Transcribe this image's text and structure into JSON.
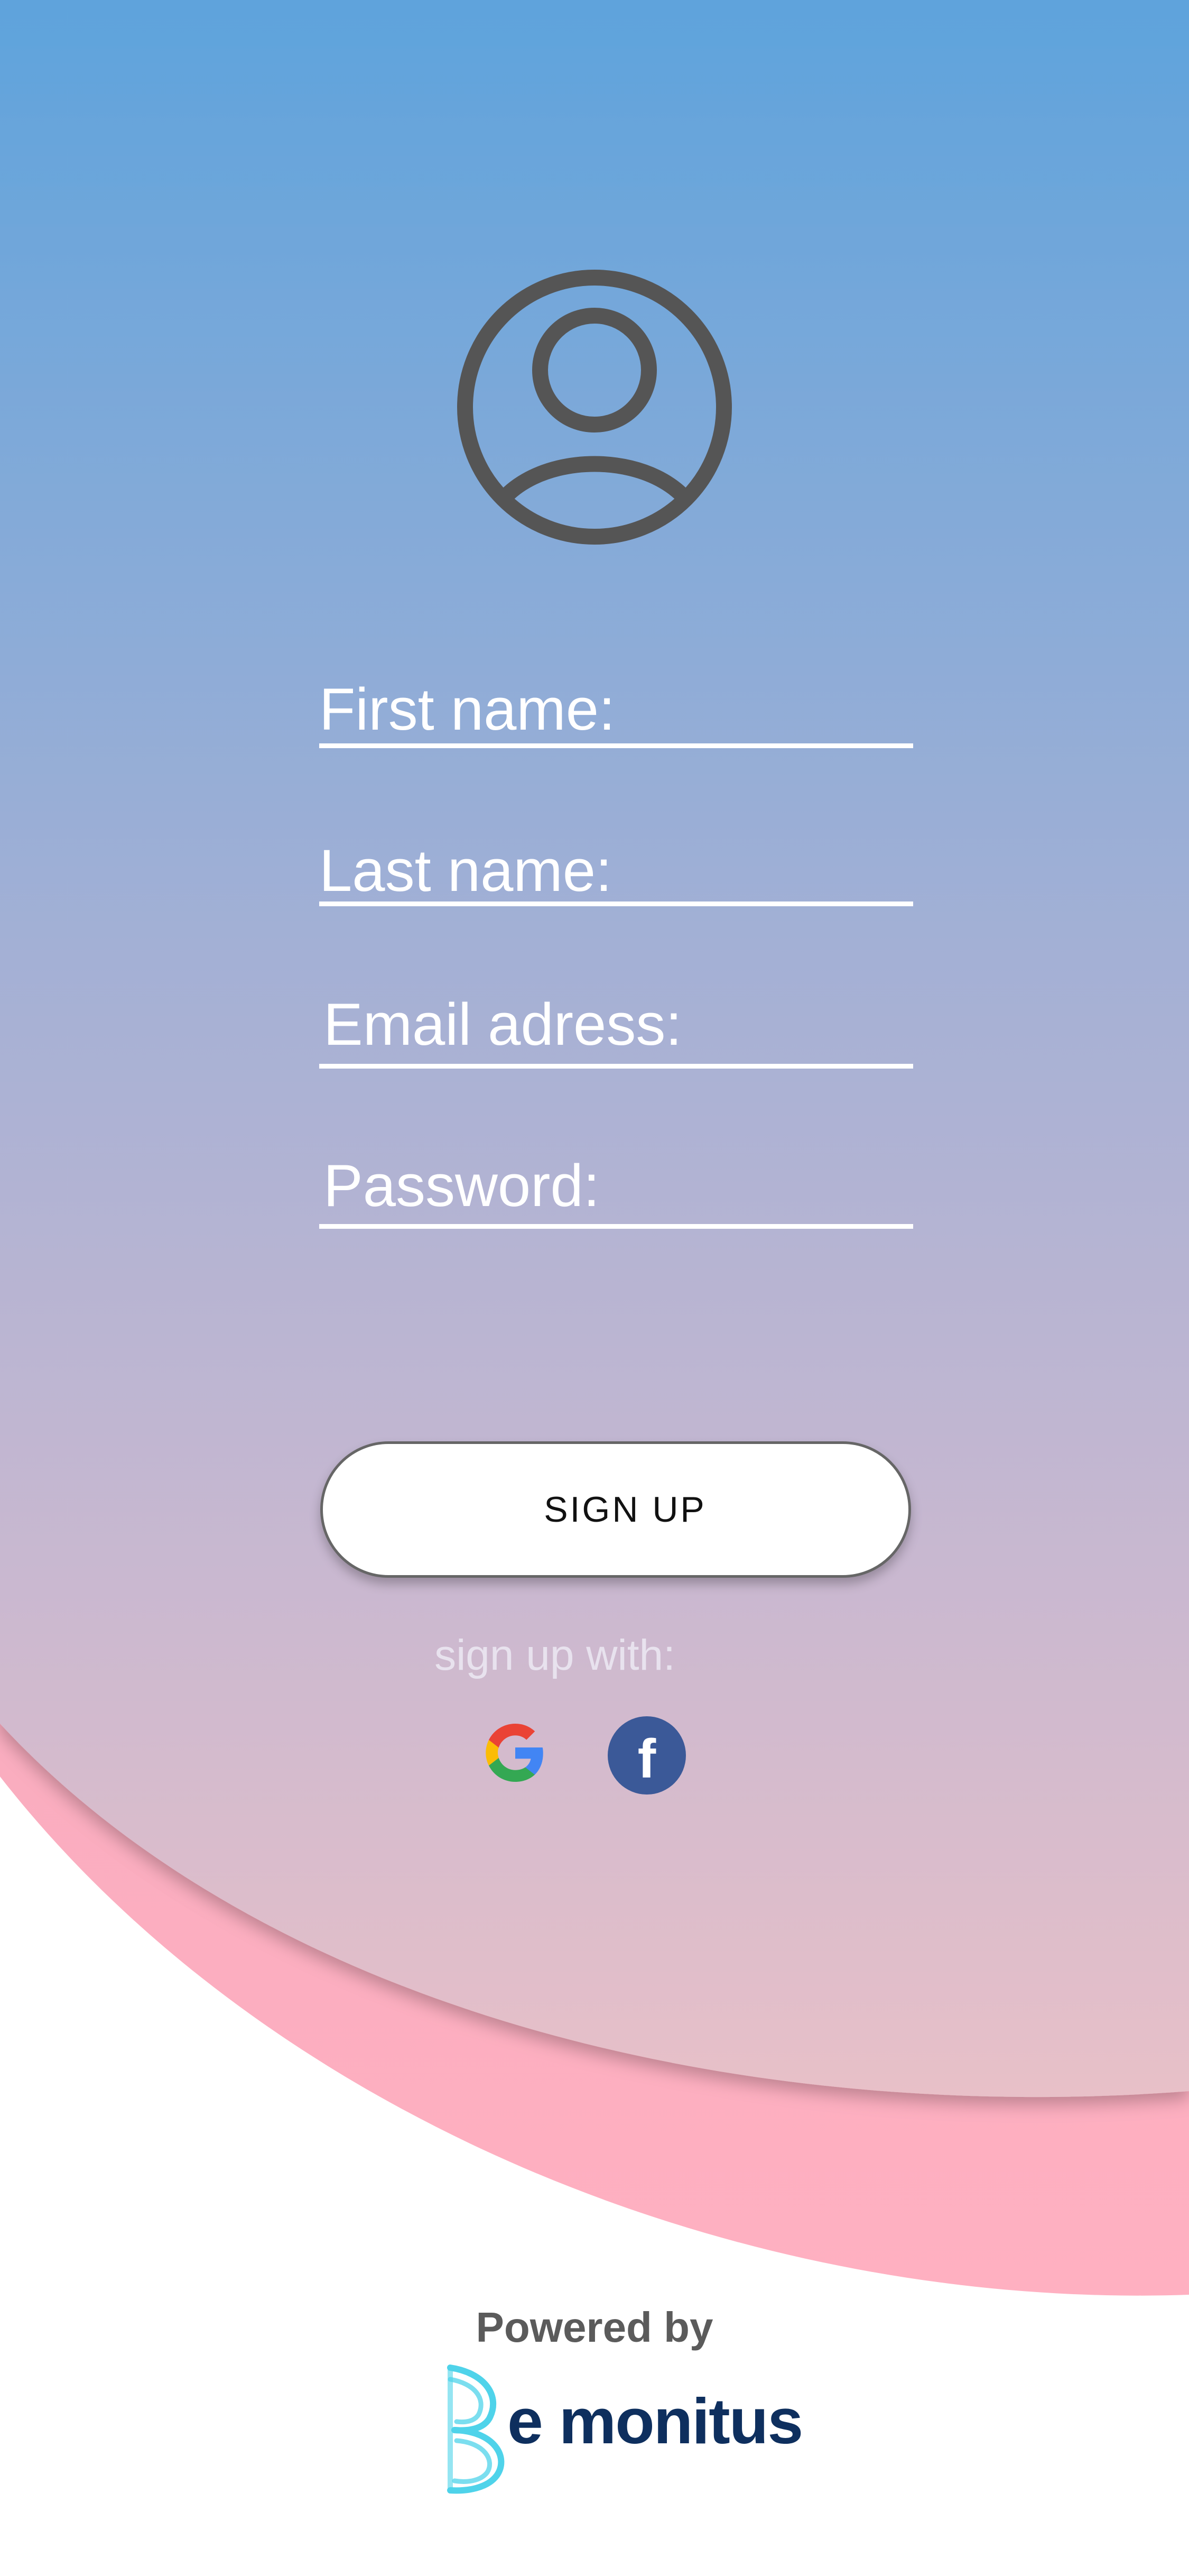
{
  "form": {
    "fields": [
      {
        "label": "First name:"
      },
      {
        "label": "Last name:"
      },
      {
        "label": "Email adress:"
      },
      {
        "label": "Password:"
      }
    ],
    "signup_button": "SIGN UP",
    "signup_with": "sign up with:"
  },
  "social": {
    "google_icon": "google-g-icon",
    "facebook_icon": "facebook-f-icon",
    "facebook_letter": "f"
  },
  "footer": {
    "powered_by": "Powered by",
    "brand_name": "e monitus"
  },
  "icons": {
    "avatar": "user-circle-icon"
  },
  "colors": {
    "gradient_top": "#5ea3dc",
    "gradient_bottom": "#e5bfc9",
    "pink_band": "#f7a7bd",
    "avatar_stroke": "#555555",
    "facebook_blue": "#3b5998",
    "brand_dark": "#0e2f5e",
    "brand_cyan": "#4fd3ea"
  }
}
